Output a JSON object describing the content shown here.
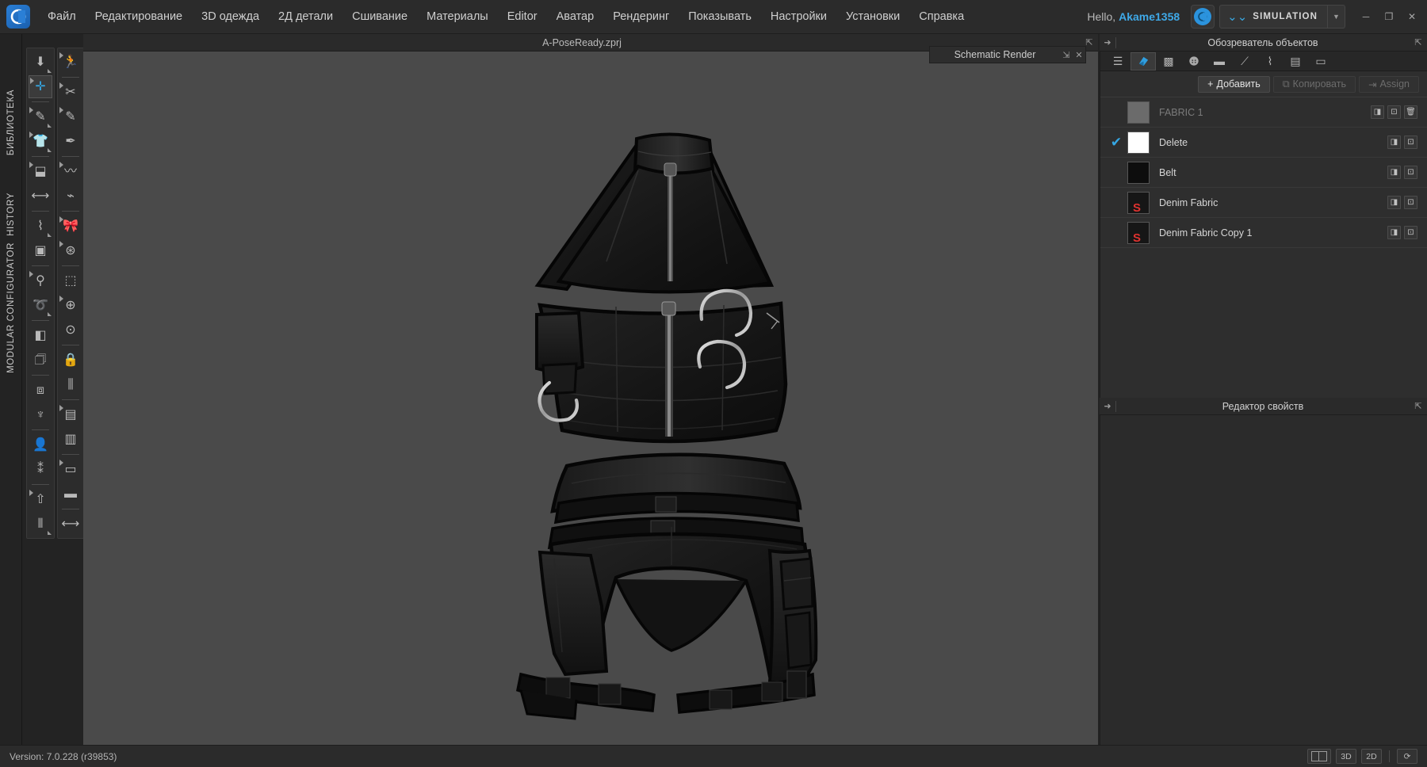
{
  "app": {
    "logo_icon": "clo-logo-icon",
    "version_status": "Version: 7.0.228 (r39853)"
  },
  "menubar": {
    "items": [
      {
        "label": "Файл"
      },
      {
        "label": "Редактирование"
      },
      {
        "label": "3D одежда"
      },
      {
        "label": "2Д детали"
      },
      {
        "label": "Сшивание"
      },
      {
        "label": "Материалы"
      },
      {
        "label": "Editor"
      },
      {
        "label": "Аватар"
      },
      {
        "label": "Рендеринг"
      },
      {
        "label": "Показывать"
      },
      {
        "label": "Настройки"
      },
      {
        "label": "Установки"
      },
      {
        "label": "Справка"
      }
    ],
    "greeting_prefix": "Hello,",
    "user_name": "Akame1358",
    "cloud_icon": "cloud-account-icon",
    "mode_chevron_icon": "double-chevron-down-icon",
    "mode_label": "SIMULATION",
    "mode_dropdown_icon": "chevron-down-icon",
    "window_minimize": "─",
    "window_maximize": "❐",
    "window_close": "✕"
  },
  "left_tabs": [
    {
      "label": "БИБЛИОТЕКА",
      "name": "sidebar-tab-library"
    },
    {
      "label": "HISTORY",
      "name": "sidebar-tab-history"
    },
    {
      "label": "MODULAR CONFIGURATOR",
      "name": "sidebar-tab-modular-configurator"
    }
  ],
  "toolbar_left_a": [
    {
      "name": "select-mesh-tool",
      "glyph": "⬇",
      "corner": true
    },
    {
      "name": "transform-tool",
      "glyph": "✛",
      "selected": true,
      "blue": true,
      "arrow": true
    },
    {
      "name": "edit-pattern-tool",
      "glyph": "✎",
      "arrow": true,
      "corner": true
    },
    {
      "name": "garment-tool",
      "glyph": "👕",
      "arrow": true,
      "corner": true
    },
    {
      "name": "fold-arrange-tool",
      "glyph": "⬓",
      "arrow": true
    },
    {
      "name": "measure-tool",
      "glyph": "⟷"
    },
    {
      "name": "pleat-tool",
      "glyph": "⌇",
      "corner": true
    },
    {
      "name": "print-layout-tool",
      "glyph": "▣"
    },
    {
      "name": "pin-tool",
      "glyph": "⚲",
      "arrow": true
    },
    {
      "name": "tack-tool",
      "glyph": "➰",
      "corner": true
    },
    {
      "name": "flatten-tool",
      "glyph": "◧"
    },
    {
      "name": "shirt-tool",
      "glyph": "🗇"
    },
    {
      "name": "jacket-tool",
      "glyph": "⧈"
    },
    {
      "name": "corset-tool",
      "glyph": "♆"
    },
    {
      "name": "avatar-tool",
      "glyph": "👤"
    },
    {
      "name": "particle-distance-tool",
      "glyph": "⁑"
    },
    {
      "name": "zipper-tool",
      "glyph": "⇧",
      "arrow": true
    },
    {
      "name": "topstitch-tool",
      "glyph": "⫴",
      "corner": true
    }
  ],
  "toolbar_left_b": [
    {
      "name": "walk-avatar-tool",
      "glyph": "🏃",
      "arrow": true
    },
    {
      "name": "sewing-tool",
      "glyph": "✂",
      "arrow": true
    },
    {
      "name": "free-sewing-tool",
      "glyph": "✎",
      "arrow": true
    },
    {
      "name": "segment-sewing-tool",
      "glyph": "✒"
    },
    {
      "name": "fabric-drape-tool",
      "glyph": "〰",
      "arrow": true
    },
    {
      "name": "curve-sewing-tool",
      "glyph": "⌁"
    },
    {
      "name": "trim-tool",
      "glyph": "🎀",
      "arrow": true
    },
    {
      "name": "button-tool",
      "glyph": "⊛",
      "arrow": true
    },
    {
      "name": "buttonhole-tool",
      "glyph": "⬚"
    },
    {
      "name": "snap-tool",
      "glyph": "⊕",
      "arrow": true
    },
    {
      "name": "snap-pair-tool",
      "glyph": "⊙"
    },
    {
      "name": "lock-snap-tool",
      "glyph": "🔒"
    },
    {
      "name": "zipper-trim-tool",
      "glyph": "⫼"
    },
    {
      "name": "fabric-roll-tool",
      "glyph": "▤",
      "arrow": true
    },
    {
      "name": "fabric-roll-2-tool",
      "glyph": "▥"
    },
    {
      "name": "tape-tool",
      "glyph": "▭",
      "arrow": true
    },
    {
      "name": "graphic-tool",
      "glyph": "▬"
    },
    {
      "name": "elastic-tool",
      "glyph": "⟷"
    }
  ],
  "toolbar_left_c": [
    {
      "name": "3d-garment-view-icon",
      "glyph": "◨",
      "selected": true
    },
    {
      "name": "garment-fit-map-icon",
      "glyph": "👕"
    },
    {
      "name": "show-garment-icon",
      "glyph": "⬒"
    },
    {
      "name": "show-pattern-icon",
      "glyph": "◳"
    },
    {
      "name": "show-avatar-icon",
      "glyph": "☻"
    },
    {
      "name": "fabric-render-icon",
      "glyph": "▰",
      "selected": true
    },
    {
      "name": "drape-preview-icon",
      "glyph": "▱"
    },
    {
      "name": "avatar-skin-icon",
      "glyph": "☺"
    },
    {
      "name": "environment-icon",
      "glyph": "🌐"
    }
  ],
  "viewport": {
    "project_title": "A-PoseReady.zprj",
    "popout_icon": "popout-icon",
    "background_color": "#4a4a4a"
  },
  "schematic": {
    "title": "Schematic Render",
    "collapse_icon": "collapse-icon",
    "close_icon": "close-icon"
  },
  "object_browser": {
    "title": "Обозреватель объектов",
    "pin_icon": "pin-icon",
    "popout_icon": "popout-icon",
    "tabs": [
      {
        "name": "object-list-tab",
        "icon": "list-icon",
        "glyph": "☰",
        "active": false
      },
      {
        "name": "fabric-tab",
        "icon": "fabric-icon",
        "glyph": "◨",
        "active": true
      },
      {
        "name": "texture-tab",
        "icon": "texture-grid-icon",
        "glyph": "▩",
        "active": false
      },
      {
        "name": "button-tab",
        "icon": "button-icon",
        "glyph": "⊛",
        "active": false
      },
      {
        "name": "topstitch-tab",
        "icon": "line-icon",
        "glyph": "▬",
        "active": false
      },
      {
        "name": "stitch-tab",
        "icon": "stitch-icon",
        "glyph": "⟋",
        "active": false
      },
      {
        "name": "zipper-tab",
        "icon": "zipper-icon",
        "glyph": "⌇",
        "active": false
      },
      {
        "name": "graphic-tab",
        "icon": "graphic-icon",
        "glyph": "▤",
        "active": false
      },
      {
        "name": "measure-tab",
        "icon": "ruler-icon",
        "glyph": "▭",
        "active": false
      }
    ],
    "actions": {
      "add_label": "Добавить",
      "add_icon": "plus-icon",
      "duplicate_label": "Копировать",
      "duplicate_icon": "copy-icon",
      "assign_label": "Assign",
      "assign_icon": "assign-icon"
    },
    "row_buttons": {
      "edit_icon": "edit-fabric-icon",
      "locate_icon": "locate-icon",
      "delete_icon": "trash-icon"
    },
    "items": [
      {
        "label": "FABRIC 1",
        "dimmed": true,
        "checked": false,
        "swatch_color": "#6b6b6b",
        "badge": "",
        "buttons": [
          "edit-fabric-icon",
          "locate-icon",
          "trash-icon"
        ]
      },
      {
        "label": "Delete",
        "dimmed": false,
        "checked": true,
        "swatch_color": "#ffffff",
        "badge": "",
        "buttons": [
          "edit-fabric-icon",
          "locate-icon"
        ]
      },
      {
        "label": "Belt",
        "dimmed": false,
        "checked": false,
        "swatch_color": "#0d0d0d",
        "badge": "",
        "buttons": [
          "edit-fabric-icon",
          "locate-icon"
        ]
      },
      {
        "label": "Denim Fabric",
        "dimmed": false,
        "checked": false,
        "swatch_color": "#161616",
        "badge": "S",
        "buttons": [
          "edit-fabric-icon",
          "locate-icon"
        ]
      },
      {
        "label": "Denim Fabric Copy 1",
        "dimmed": false,
        "checked": false,
        "swatch_color": "#161616",
        "badge": "S",
        "buttons": [
          "edit-fabric-icon",
          "locate-icon"
        ]
      }
    ]
  },
  "property_editor": {
    "title": "Редактор свойств",
    "pin_icon": "pin-icon",
    "popout_icon": "popout-icon"
  },
  "statusbar": {
    "split_view_icon": "split-view-icon",
    "view_3d_label": "3D",
    "view_2d_label": "2D",
    "reset_icon": "reset-icon"
  },
  "colors": {
    "accent": "#35a7e4",
    "panel_bg": "#2e2e2e",
    "menubar_bg": "#2b2b2b",
    "viewport_bg": "#4a4a4a",
    "badge_red": "#e0322f"
  }
}
